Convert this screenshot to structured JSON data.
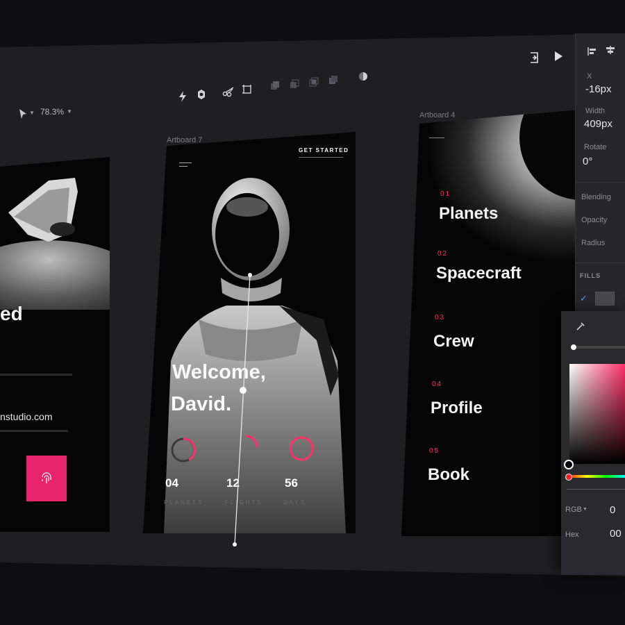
{
  "toolbar": {
    "zoom": "78.3%"
  },
  "artboards": {
    "left": {
      "heading_fragment": "ed",
      "email_fragment": "nstudio.com"
    },
    "center": {
      "label": "Artboard 7",
      "cta": "GET STARTED",
      "welcome_line1": "Welcome,",
      "welcome_line2": "David.",
      "stats": [
        {
          "value": "04",
          "label": "PLANETS"
        },
        {
          "value": "12",
          "label": "FLIGHTS"
        },
        {
          "value": "56",
          "label": "DAYS"
        }
      ]
    },
    "right": {
      "label": "Artboard 4",
      "menu": [
        {
          "num": "01",
          "label": "Planets"
        },
        {
          "num": "02",
          "label": "Spacecraft"
        },
        {
          "num": "03",
          "label": "Crew"
        },
        {
          "num": "04",
          "label": "Profile"
        },
        {
          "num": "05",
          "label": "Book"
        }
      ]
    }
  },
  "inspector": {
    "x_label": "X",
    "x_value": "-16px",
    "width_label": "Width",
    "width_value": "409px",
    "rotate_label": "Rotate",
    "rotate_value": "0°",
    "blending_label": "Blending",
    "opacity_label": "Opacity",
    "radius_label": "Radius",
    "fills_label": "FILLS"
  },
  "color_picker": {
    "mode_label": "RGB",
    "mode_value": "0",
    "hex_label": "Hex",
    "hex_value": "00"
  },
  "colors": {
    "accent": "#ff2f6a",
    "background": "#1f1f22",
    "panel": "#27272b"
  }
}
